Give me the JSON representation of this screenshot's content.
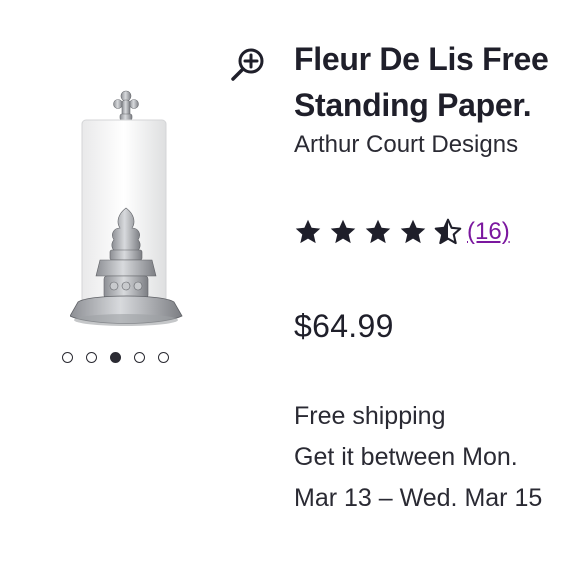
{
  "product": {
    "title_line1": "Fleur De Lis Free",
    "title_line2": "Standing Paper.",
    "brand": "Arthur Court Designs",
    "rating": 4.5,
    "review_count": "(16)",
    "price": "$64.99",
    "shipping_label": "Free shipping",
    "delivery_line1": "Get it between Mon.",
    "delivery_line2": "Mar 13 – Wed. Mar 15"
  },
  "gallery": {
    "dot_count": 5,
    "active_index": 2
  },
  "colors": {
    "text": "#1f1f2a",
    "link": "#7b189f",
    "star": "#1f1f2a"
  },
  "icons": {
    "zoom": "zoom-in-icon",
    "star_full": "star-filled-icon",
    "star_half": "star-half-icon"
  }
}
